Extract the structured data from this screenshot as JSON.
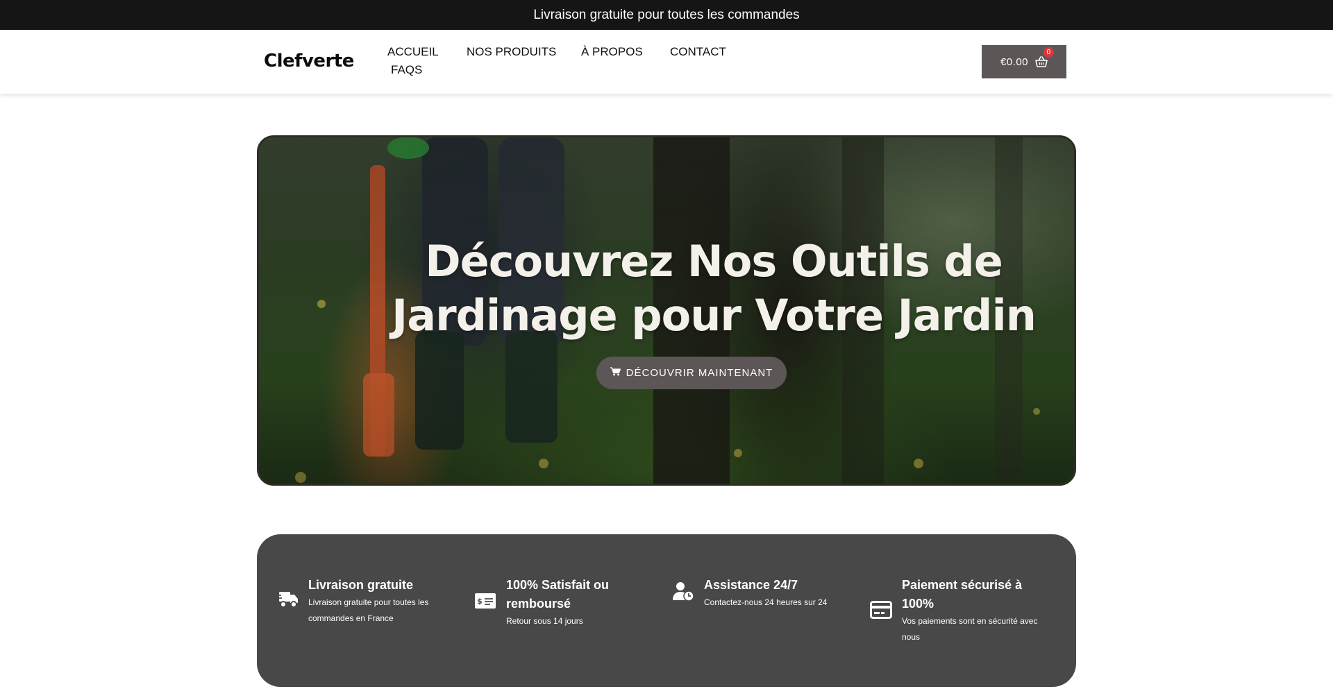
{
  "announcement": {
    "text": "Livraison gratuite pour toutes les commandes"
  },
  "header": {
    "logo": "Clefverte",
    "nav": [
      {
        "label": "ACCUEIL"
      },
      {
        "label": "NOS PRODUITS"
      },
      {
        "label": "À PROPOS"
      },
      {
        "label": "CONTACT"
      },
      {
        "label": "FAQS"
      }
    ],
    "cart": {
      "total": "€0.00",
      "count": "0",
      "icon": "basket-icon"
    }
  },
  "hero": {
    "title": "Découvrez Nos Outils de Jardinage pour Votre Jardin",
    "cta_label": "DÉCOUVRIR MAINTENANT",
    "cta_icon": "cart-icon"
  },
  "features": [
    {
      "icon": "delivery-truck-icon",
      "title": "Livraison gratuite",
      "description": "Livraison gratuite pour toutes les commandes en France"
    },
    {
      "icon": "money-bill-icon",
      "title": "100% Satisfait ou remboursé",
      "description": "Retour sous 14 jours"
    },
    {
      "icon": "user-clock-icon",
      "title": "Assistance 24/7",
      "description": "Contactez-nous 24 heures sur 24"
    },
    {
      "icon": "credit-card-icon",
      "title": "Paiement sécurisé à 100%",
      "description": "Vos paiements sont en sécurité avec nous"
    }
  ],
  "colors": {
    "topbar_bg": "#151515",
    "button_bg": "#5c5656",
    "badge": "#d9383c",
    "features_bg": "#494848"
  }
}
